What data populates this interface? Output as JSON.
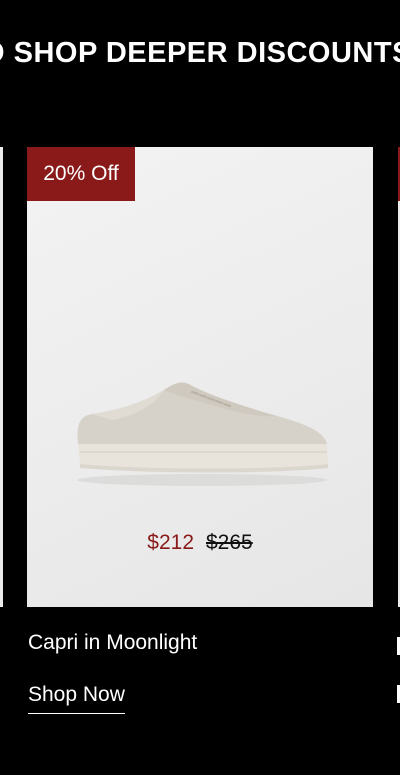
{
  "banner": {
    "text": "O SHOP DEEPER DISCOUNTS"
  },
  "product": {
    "badge": "20% Off",
    "sale_price": "$212",
    "original_price": "$265",
    "name": "Capri in Moonlight",
    "cta": "Shop Now"
  },
  "colors": {
    "background": "#000000",
    "badge": "#8a1a1a",
    "sale_price": "#8a1a1a",
    "card": "#ececec",
    "text": "#ffffff"
  }
}
